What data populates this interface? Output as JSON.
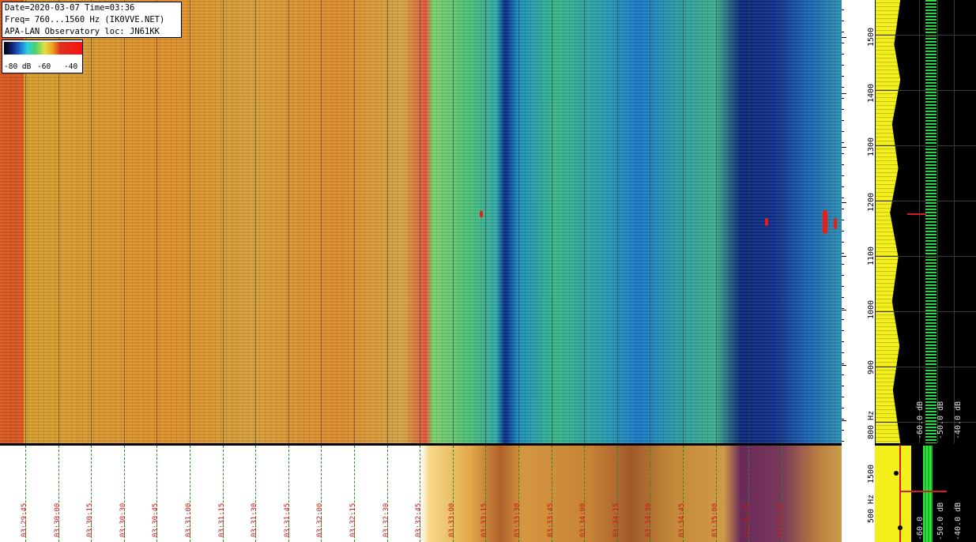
{
  "info": {
    "line1": "Date=2020-03-07 Time=03:36",
    "line2": "Freq= 760...1560 Hz (IK0VVE.NET)",
    "line3": "APA-LAN Observatory loc: JN61KK"
  },
  "legend": {
    "label_a": "-80 dB",
    "label_b": "-60",
    "label_c": "-40"
  },
  "freq_axis": {
    "labels": [
      "1500",
      "1400",
      "1300",
      "1200",
      "1100",
      "1000",
      "900",
      "800 Hz"
    ]
  },
  "bottom_axis": {
    "labels": [
      "1500",
      "500 Hz"
    ]
  },
  "power_axis": {
    "top_labels": [
      "-60.0 dB",
      "-50.0 dB",
      "-40.0 dB"
    ],
    "bottom_labels": [
      "-60.0",
      "-50.0 dB",
      "-40.0 dB"
    ]
  },
  "time_labels": [
    "03:29:45",
    "03:30:00",
    "03:30:15",
    "03:30:30",
    "03:30:45",
    "03:31:00",
    "03:31:15",
    "03:31:30",
    "03:31:45",
    "03:32:00",
    "03:32:15",
    "03:32:30",
    "03:32:45",
    "03:33:00",
    "03:33:15",
    "03:33:30",
    "03:33:45",
    "03:34:00",
    "03:34:15",
    "03:34:30",
    "03:34:45",
    "03:35:00",
    "03:35:15",
    "03:35:30"
  ],
  "colors": {
    "grid_dash": "#2a8a2a",
    "time_label": "#c41a1a",
    "trace_yellow": "#f0ee1a",
    "trace_green": "#36e046"
  }
}
